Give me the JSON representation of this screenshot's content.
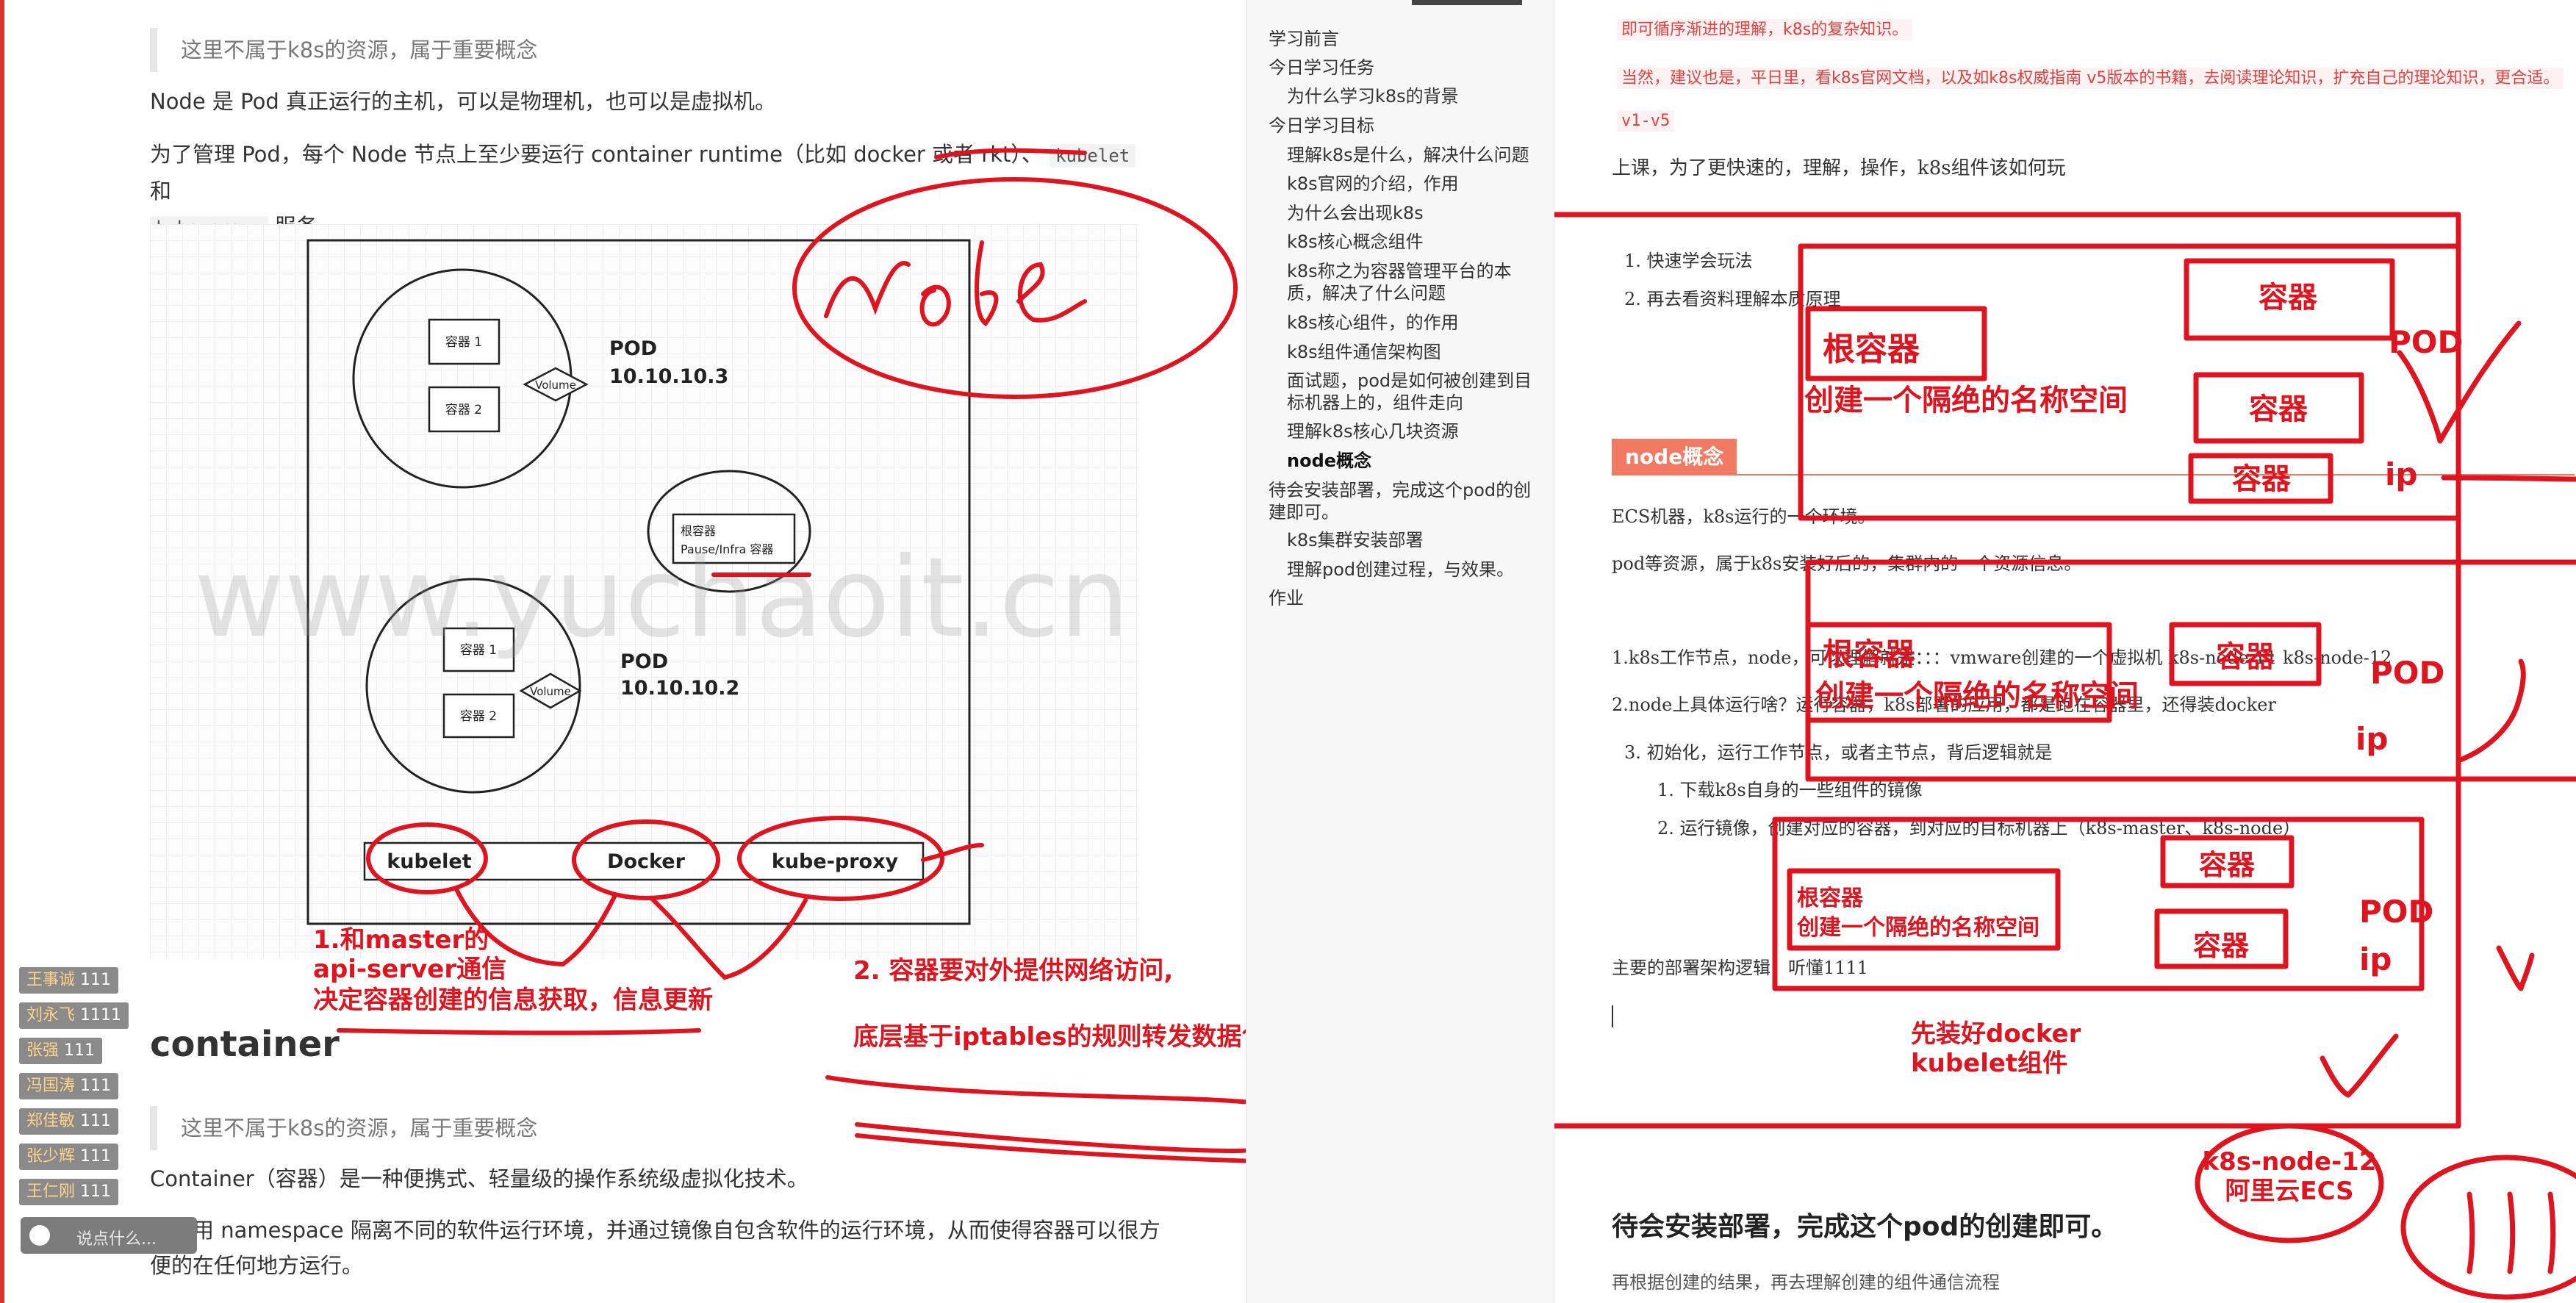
{
  "left": {
    "note1": "这里不属于k8s的资源，属于重要概念",
    "para1": "Node 是 Pod 真正运行的主机，可以是物理机，也可以是虚拟机。",
    "para2a": "为了管理 Pod，每个 Node 节点上至少要运行 container runtime（比如 docker 或者 rkt）、",
    "code_kubelet": "kubelet",
    "para2b": "和",
    "code_kubeproxy": "kube-proxy",
    "para2c": "服务。",
    "heading_container": "container",
    "note2": "这里不属于k8s的资源，属于重要概念",
    "para3": "Container（容器）是一种便携式、轻量级的操作系统级虚拟化技术。",
    "para4a": "它使用 namespace 隔离不同的软件运行环境，并通过镜像自包含软件的运行环境，从而使得容器可以很方",
    "para4b": "便的在任何地方运行。",
    "watermark": "www.yuchaoit.cn",
    "diagram": {
      "pod1_title": "POD",
      "pod1_ip": "10.10.10.3",
      "pod2_title": "POD",
      "pod2_ip": "10.10.10.2",
      "container1": "容器 1",
      "container2": "容器 2",
      "volume": "Volume",
      "infra1": "根容器",
      "infra2": "Pause/Infra 容器",
      "kubelet": "kubelet",
      "docker": "Docker",
      "kubeproxy": "kube-proxy"
    },
    "annotations": {
      "node": "Node",
      "a1_line1": "1.和master的",
      "a1_line2": "api-server通信",
      "a1_line3": "决定容器创建的信息获取，信息更新",
      "a2_line1": "2. 容器要对外提供网络访问,",
      "a2_line2": "底层基于iptables的规则转发数据包，修改数据包"
    },
    "danmaku": [
      {
        "name": "王事诚",
        "msg": "111"
      },
      {
        "name": "刘永飞",
        "msg": "1111"
      },
      {
        "name": "张强",
        "msg": "111"
      },
      {
        "name": "冯国涛",
        "msg": "111"
      },
      {
        "name": "郑佳敏",
        "msg": "111"
      },
      {
        "name": "张少辉",
        "msg": "111"
      },
      {
        "name": "王仁刚",
        "msg": "111"
      }
    ],
    "chat_placeholder": "说点什么..."
  },
  "toc": {
    "items": [
      {
        "label": "学习前言",
        "level": 0
      },
      {
        "label": "今日学习任务",
        "level": 0
      },
      {
        "label": "为什么学习k8s的背景",
        "level": 1
      },
      {
        "label": "今日学习目标",
        "level": 0
      },
      {
        "label": "理解k8s是什么，解决什么问题",
        "level": 1
      },
      {
        "label": "k8s官网的介绍，作用",
        "level": 1
      },
      {
        "label": "为什么会出现k8s",
        "level": 1
      },
      {
        "label": "k8s核心概念组件",
        "level": 1
      },
      {
        "label": "k8s称之为容器管理平台的本质，解决了什么问题",
        "level": 1
      },
      {
        "label": "k8s核心组件，的作用",
        "level": 1
      },
      {
        "label": "k8s组件通信架构图",
        "level": 1
      },
      {
        "label": "面试题，pod是如何被创建到目标机器上的，组件走向",
        "level": 1
      },
      {
        "label": "理解k8s核心几块资源",
        "level": 1
      },
      {
        "label": "node概念",
        "level": 1,
        "active": true
      },
      {
        "label": "待会安装部署，完成这个pod的创建即可。",
        "level": 0
      },
      {
        "label": "k8s集群安装部署",
        "level": 1
      },
      {
        "label": "理解pod创建过程，与效果。",
        "level": 1
      },
      {
        "label": "作业",
        "level": 0
      }
    ]
  },
  "right": {
    "red1": "即可循序渐进的理解，k8s的复杂知识。",
    "red2": "当然，建议也是，平日里，看k8s官网文档，以及如k8s权威指南 v5版本的书籍，去阅读理论知识，扩充自己的理论知识，更合适。",
    "red3": "v1-v5",
    "line1": "上课，为了更快速的，理解，操作，k8s组件该如何玩",
    "list1": "1. 快速学会玩法",
    "list2": "2. 再去看资料理解本质原理",
    "node_heading": "node概念",
    "t1": "ECS机器，k8s运行的一个环境。",
    "t2": "pod等资源，属于k8s安装好后的，集群内的一个资源信息。",
    "t3": "1.k8s工作节点，node，可以理解就是：：：vmware创建的一个虚拟机 k8s-node-11  k8s-node-12",
    "t4": "2.node上具体运行啥？运行容器，k8s部署的应用，都是跑在容器里，还得装docker",
    "t5": "3. 初始化，运行工作节点，或者主节点，背后逻辑就是",
    "t6": "1. 下载k8s自身的一些组件的镜像",
    "t7": "2. 运行镜像，创建对应的容器，到对应的目标机器上（k8s-master、k8s-node）",
    "t8": "主要的部署架构逻辑，听懂1111",
    "bottom_heading": "待会安装部署，完成这个pod的创建即可。",
    "bottom_cut": "再根据创建的结果，再去理解创建的组件通信流程",
    "annotations": {
      "container": "容器",
      "root_container": "根容器",
      "namespace": "创建一个隔绝的名称空间",
      "pod": "POD",
      "ip": "ip",
      "install1": "先装好docker",
      "install2": "kubelet组件",
      "ecs1": "k8s-node-12",
      "ecs2": "阿里云ECS",
      "ones": "111"
    }
  }
}
